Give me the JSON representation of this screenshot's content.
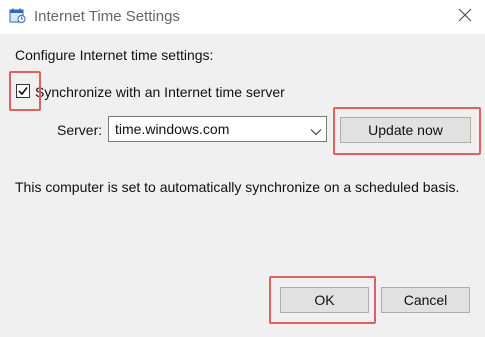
{
  "window": {
    "title": "Internet Time Settings",
    "icon": "date-time-settings-icon",
    "close_icon": "close-icon"
  },
  "settings": {
    "section_label": "Configure Internet time settings:",
    "sync_checkbox": {
      "label": "Synchronize with an Internet time server",
      "checked": true
    },
    "server": {
      "label": "Server:",
      "value": "time.windows.com"
    },
    "update_button_label": "Update now",
    "status_text": "This computer is set to automatically synchronize on a scheduled basis."
  },
  "footer": {
    "ok_label": "OK",
    "cancel_label": "Cancel"
  },
  "colors": {
    "highlight": "#e06060",
    "dialog_bg": "#f0f0f0",
    "button_bg": "#e1e1e1"
  }
}
